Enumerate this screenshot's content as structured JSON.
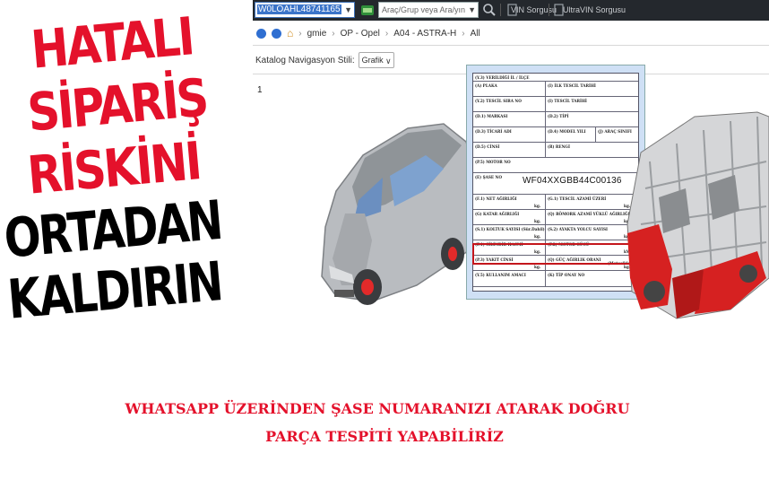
{
  "slogan": {
    "line1": "HATALI",
    "line2": "SİPARİŞ",
    "line3": "RİSKİNİ",
    "line4": "ORTADAN",
    "line5": "KALDIRIN"
  },
  "toolbar": {
    "vin_value": "W0LOAHL48741165",
    "search_placeholder": "Araç/Grup veya Ara/yın",
    "vin_button": "VIN Sorgusu",
    "ultra_vin_button": "UltraVIN Sorgusu"
  },
  "breadcrumb": {
    "items": [
      "gmie",
      "OP - Opel",
      "A04 - ASTRA-H",
      "All"
    ]
  },
  "catalog": {
    "label": "Katalog Navigasyon Stili:",
    "selected": "Grafik"
  },
  "page_number": "1",
  "registration_doc": {
    "rows": [
      {
        "left": "(Y.3) VERİLDİĞİ İL / İLÇE",
        "mid": ""
      },
      {
        "left": "(A) PLAKA",
        "mid": "(I) İLK TESCİL TARİHİ"
      },
      {
        "left": "(Y.2) TESCİL SIRA NO",
        "mid": "(I) TESCİL TARİHİ"
      },
      {
        "left": "(D.1) MARKASI",
        "mid": "(D.2) TİPİ"
      },
      {
        "left": "(D.3) TİCARİ ADI",
        "mid": "(D.4) MODEL YILI",
        "right": "(J) ARAÇ SINIFI"
      },
      {
        "left": "(D.5) CİNSİ",
        "mid": "(R) RENGİ"
      },
      {
        "left": "(P.5) MOTOR NO",
        "mid": ""
      },
      {
        "left": "(E) ŞASE NO",
        "mid": ""
      },
      {
        "left": "(F.1) NET AĞIRLIĞI",
        "mid": "(G.1) TESCİL AZAMİ ÜZERİ"
      },
      {
        "left": "(G) KATAR AĞIRLIĞI",
        "mid": "(Q) RÖMORK AZAMİ YÜKLÜ AĞIRLIĞI"
      },
      {
        "left": "(S.1) KOLTUK SAYISI (Sür.Dahil)",
        "mid": "(S.2) AYAKTA YOLCU SAYISI"
      },
      {
        "left": "(P.1) SİLİNDİR HACMİ",
        "mid": "(P.2) MOTOR GÜCÜ"
      },
      {
        "left": "(P.3) YAKIT CİNSİ",
        "mid": "(Q) GÜÇ AĞIRLIK ORANI"
      },
      {
        "left": "(Y.5) KULLANIM AMACI",
        "mid": "(K) TİP ONAY NO"
      }
    ],
    "unit_kg": "kg.",
    "unit_kw": "kW",
    "unit_kwkg": "(Motosikletler için)",
    "chassis_number": "WF04XXGBB44C00136"
  },
  "caption": {
    "line1": "WHATSAPP ÜZERİNDEN ŞASE NUMARANIZI ATARAK DOĞRU",
    "line2": "PARÇA TESPİTİ YAPABİLİRİZ"
  },
  "colors": {
    "brand_red": "#e4112b",
    "toolbar_bg": "#24282d",
    "highlight": "#c4161c"
  }
}
